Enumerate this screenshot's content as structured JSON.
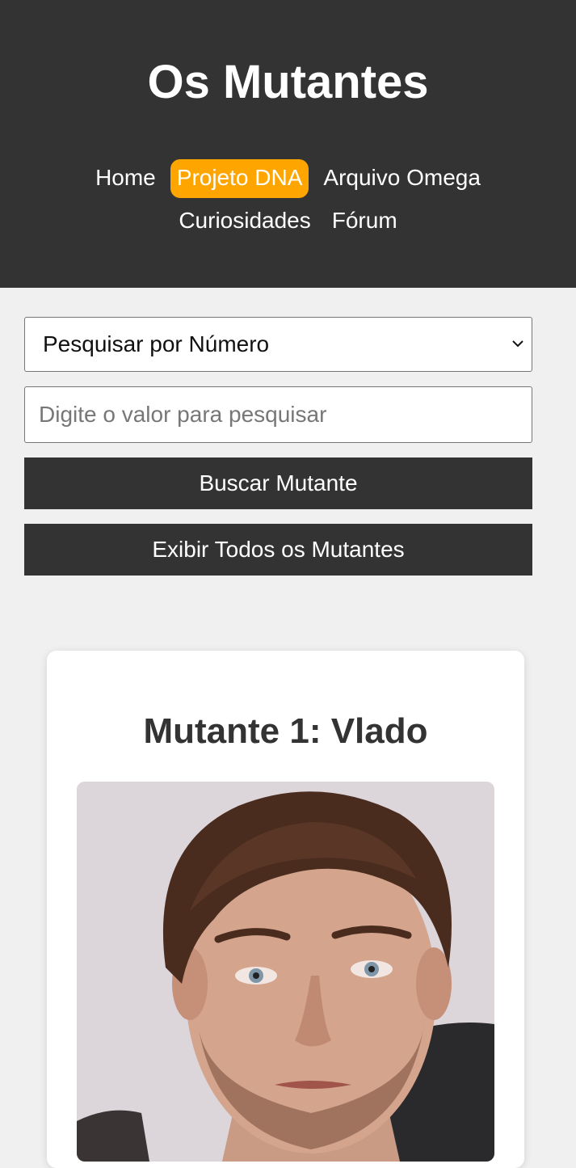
{
  "header": {
    "title": "Os Mutantes",
    "nav": [
      {
        "label": "Home",
        "active": false
      },
      {
        "label": "Projeto DNA",
        "active": true
      },
      {
        "label": "Arquivo Omega",
        "active": false
      },
      {
        "label": "Curiosidades",
        "active": false
      },
      {
        "label": "Fórum",
        "active": false
      }
    ]
  },
  "search": {
    "select_value": "Pesquisar por Número",
    "input_value": "",
    "input_placeholder": "Digite o valor para pesquisar",
    "search_button": "Buscar Mutante",
    "show_all_button": "Exibir Todos os Mutantes"
  },
  "card": {
    "title": "Mutante 1: Vlado"
  },
  "colors": {
    "header_bg": "#333333",
    "accent": "#ffa500",
    "page_bg": "#f0f0f0",
    "button_bg": "#333333"
  },
  "icons": {
    "select_arrow": "chevron-down-icon"
  }
}
